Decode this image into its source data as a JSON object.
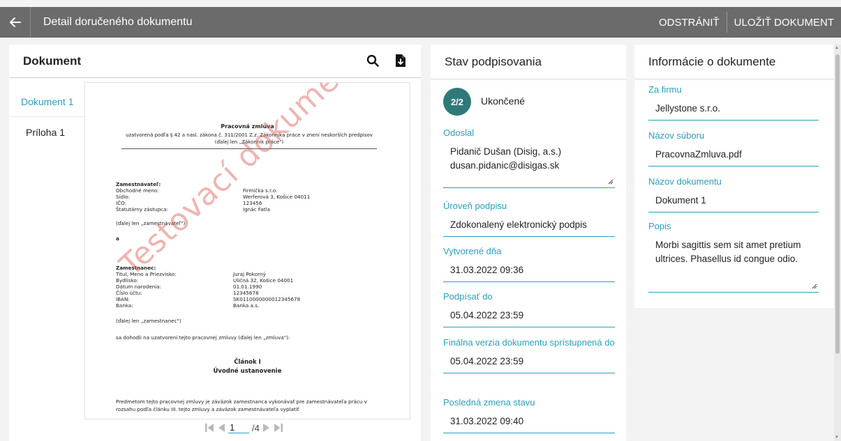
{
  "header": {
    "title": "Detail doručeného dokumentu",
    "actions": {
      "delete": "ODSTRÁNIŤ",
      "save": "ULOŽIŤ DOKUMENT"
    }
  },
  "document_panel": {
    "title": "Dokument",
    "tabs": [
      {
        "label": "Dokument 1",
        "active": true
      },
      {
        "label": "Príloha 1",
        "active": false
      }
    ],
    "pager": {
      "current": "1",
      "total": "/4"
    },
    "preview": {
      "title": "Pracovná zmluva",
      "subtitle": "uzatvorená podľa § 42 a nasl. zákona č. 311/2001 Z.z. Zákonníka práce v znení neskorších predpisov (ďalej len „Zákonník práce\")",
      "employer_heading": "Zamestnávateľ:",
      "employer_rows": [
        {
          "k": "Obchodné meno:",
          "v": "Firmička s.r.o."
        },
        {
          "k": "Sídlo:",
          "v": "Werferová 3, Košice 04011"
        },
        {
          "k": "IČO:",
          "v": "123456"
        },
        {
          "k": "Štatutárny zástupca:",
          "v": "Ignác Fatla"
        }
      ],
      "employer_note": "(ďalej len „zamestnávateľ\")",
      "and": "a",
      "employee_heading": "Zamestnanec:",
      "employee_rows": [
        {
          "k": "Titul, Meno a Priezvisko:",
          "v": "Juraj Pokorný"
        },
        {
          "k": "Bydlisko:",
          "v": "Uličná 32, Košice 04001"
        },
        {
          "k": "Dátum narodenia:",
          "v": "01.01.1990"
        },
        {
          "k": "Číslo účtu:",
          "v": "12345678"
        },
        {
          "k": "IBAN:",
          "v": "SK0110000000012345678"
        },
        {
          "k": "Banka:",
          "v": "Banka a.s."
        }
      ],
      "employee_note": "(ďalej len „zamestnanec\")",
      "agreement": "sa dohodli na uzatvorení tejto pracovnej zmluvy (ďalej len „zmluva\"):",
      "article": "Článok I",
      "article_title": "Úvodné ustanovenie",
      "paragraph": "Predmetom tejto pracovnej zmluvy je záväzok zamestnanca vykonávať pre zamestnávateľa prácu v rozsahu podľa článku III. tejto zmluvy a záväzok zamestnávateľa vyplatiť",
      "watermark": "Testovací dokument"
    }
  },
  "signing_panel": {
    "title": "Stav podpisovania",
    "status_badge": "2/2",
    "status_text": "Ukončené",
    "sender_label": "Odoslal",
    "sender_name": "Pidanič Dušan (Disig, a.s.)",
    "sender_email": "dusan.pidanic@disigas.sk",
    "level_label": "Úroveň podpisu",
    "level_value": "Zdokonalený elektronický podpis",
    "created_label": "Vytvorené dňa",
    "created_value": "31.03.2022 09:36",
    "sign_by_label": "Podpísať do",
    "sign_by_value": "05.04.2022 23:59",
    "final_label": "Finálna verzia dokumentu sprístupnená do",
    "final_value": "05.04.2022 23:59",
    "last_change_label": "Posledná zmena stavu",
    "last_change_value": "31.03.2022 09:40"
  },
  "info_panel": {
    "title": "Informácie o dokumente",
    "company_label": "Za firmu",
    "company_value": "Jellystone s.r.o.",
    "file_label": "Názov súboru",
    "file_value": "PracovnaZmluva.pdf",
    "doc_name_label": "Názov dokumentu",
    "doc_name_value": "Dokument 1",
    "desc_label": "Popis",
    "desc_value": "Morbi sagittis sem sit amet pretium ultrices. Phasellus id congue odio."
  },
  "colors": {
    "accent": "#2aa0bd",
    "topbar": "#6b6b6b",
    "badge": "#2e7a7a",
    "watermark": "#dc5a50"
  }
}
